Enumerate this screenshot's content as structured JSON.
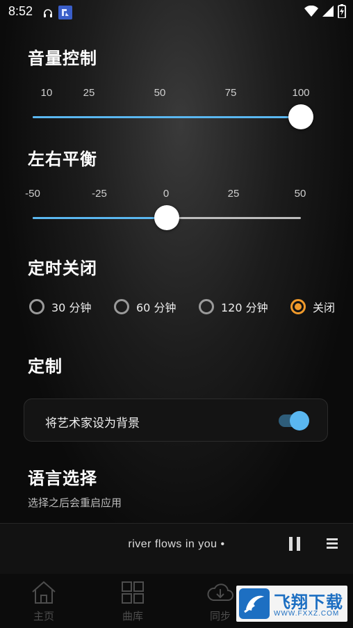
{
  "status_bar": {
    "time": "8:52",
    "left_icons": [
      "headphones-icon",
      "app-notification-icon"
    ],
    "right_icons": [
      "wifi-icon",
      "cell-signal-icon",
      "battery-charging-icon"
    ]
  },
  "volume": {
    "title": "音量控制",
    "ticks": [
      "10",
      "25",
      "50",
      "75",
      "100"
    ],
    "value": 100,
    "range": [
      10,
      100
    ],
    "accent_color": "#5ab7f0"
  },
  "balance": {
    "title": "左右平衡",
    "ticks": [
      "-50",
      "-25",
      "0",
      "25",
      "50"
    ],
    "value": 0,
    "range": [
      -50,
      50
    ]
  },
  "timer": {
    "title": "定时关闭",
    "options": [
      {
        "label": "30 分钟",
        "checked": false
      },
      {
        "label": "60 分钟",
        "checked": false
      },
      {
        "label": "120 分钟",
        "checked": false
      },
      {
        "label": "关闭",
        "checked": true
      }
    ],
    "accent_color": "#f09a2b"
  },
  "customize": {
    "title": "定制",
    "artist_background_label": "将艺术家设为背景",
    "artist_background_on": true
  },
  "language": {
    "title": "语言选择",
    "subtitle": "选择之后会重启应用"
  },
  "player": {
    "song": "river  flows  in  you •",
    "pause_icon": "pause-icon",
    "menu_icon": "menu-icon"
  },
  "bottom_nav": {
    "items": [
      {
        "label": "主页",
        "icon": "home-icon"
      },
      {
        "label": "曲库",
        "icon": "library-grid-icon"
      },
      {
        "label": "同步",
        "icon": "cloud-download-icon"
      }
    ]
  },
  "watermark": {
    "brand": "飞翔下载",
    "url": "WWW.FXXZ.COM"
  }
}
